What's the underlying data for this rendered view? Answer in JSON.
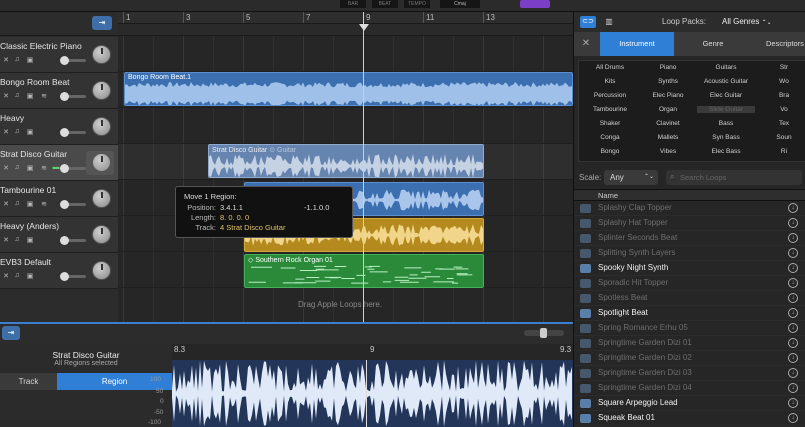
{
  "lcd": {
    "bar": "BAR",
    "beat": "BEAT",
    "tempo": "TEMPO",
    "key": "Cmaj"
  },
  "ruler": {
    "marks": [
      "1",
      "3",
      "5",
      "7",
      "9",
      "11",
      "13"
    ]
  },
  "tracks": [
    {
      "name": "Classic Electric Piano",
      "selected": false
    },
    {
      "name": "Bongo Room Beat",
      "selected": false
    },
    {
      "name": "Heavy",
      "selected": false
    },
    {
      "name": "Strat Disco Guitar",
      "selected": true
    },
    {
      "name": "Tambourine 01",
      "selected": false
    },
    {
      "name": "Heavy (Anders)",
      "selected": false
    },
    {
      "name": "EVB3 Default",
      "selected": false
    }
  ],
  "regions": {
    "bongo": "Bongo Room Beat.1",
    "strat": "Strat Disco Guitar",
    "strat_ghost": "Guitar",
    "organ": "Southern Rock Organ 01"
  },
  "colors": {
    "blue": "#3b6fb0",
    "yellow": "#b48a1e",
    "green": "#2a8a3a",
    "accent": "#2f7fd6",
    "strat": "#6c8fbf"
  },
  "tooltip": {
    "title": "Move 1 Region:",
    "position_label": "Position:",
    "position": "3.4.1.1",
    "offset": "-1.1.0.0",
    "length_label": "Length:",
    "length": "8. 0. 0. 0",
    "track_label": "Track:",
    "track": "4  Strat Disco Guitar"
  },
  "drag_hint": "Drag Apple Loops here.",
  "browser": {
    "loop_packs_label": "Loop Packs:",
    "loop_packs_value": "All Genres",
    "tabs": [
      "Instrument",
      "Genre",
      "Descriptors"
    ],
    "keywords": [
      [
        "All Drums",
        "Piano",
        "Guitars",
        "Str"
      ],
      [
        "Kits",
        "Synths",
        "Acoustic Guitar",
        "Wo"
      ],
      [
        "Percussion",
        "Elec Piano",
        "Elec Guitar",
        "Bra"
      ],
      [
        "Tambourine",
        "Organ",
        "Slide Guitar",
        "Vo"
      ],
      [
        "Shaker",
        "Clavinet",
        "Bass",
        "Tex"
      ],
      [
        "Conga",
        "Mallets",
        "Syn Bass",
        "Soun"
      ],
      [
        "Bongo",
        "Vibes",
        "Elec Bass",
        "Ri"
      ]
    ],
    "scale_label": "Scale:",
    "scale_value": "Any",
    "search_placeholder": "Search Loops",
    "list_header": "Name",
    "loops": [
      {
        "name": "Splashy Clap Topper",
        "dim": true
      },
      {
        "name": "Splashy Hat Topper",
        "dim": true
      },
      {
        "name": "Splinter Seconds Beat",
        "dim": true
      },
      {
        "name": "Splitting Synth Layers",
        "dim": true
      },
      {
        "name": "Spooky Night Synth",
        "dim": false
      },
      {
        "name": "Sporadic Hit Topper",
        "dim": true
      },
      {
        "name": "Spotless Beat",
        "dim": true
      },
      {
        "name": "Spotlight Beat",
        "dim": false
      },
      {
        "name": "Spring Romance Erhu 05",
        "dim": true
      },
      {
        "name": "Springtime Garden Dizi 01",
        "dim": true
      },
      {
        "name": "Springtime Garden Dizi 02",
        "dim": true
      },
      {
        "name": "Springtime Garden Dizi 03",
        "dim": true
      },
      {
        "name": "Springtime Garden Dizi 04",
        "dim": true
      },
      {
        "name": "Square Arpeggio Lead",
        "dim": false
      },
      {
        "name": "Squeak Beat 01",
        "dim": false
      },
      {
        "name": "Squeak Beat 02",
        "dim": false
      }
    ]
  },
  "editor": {
    "track_name": "Strat Disco Guitar",
    "sub": "All Regions selected",
    "tab_track": "Track",
    "tab_region": "Region",
    "ruler": [
      "8.3",
      "9",
      "9.3"
    ],
    "scale": [
      "100",
      "50",
      "0",
      "-50",
      "-100"
    ]
  }
}
